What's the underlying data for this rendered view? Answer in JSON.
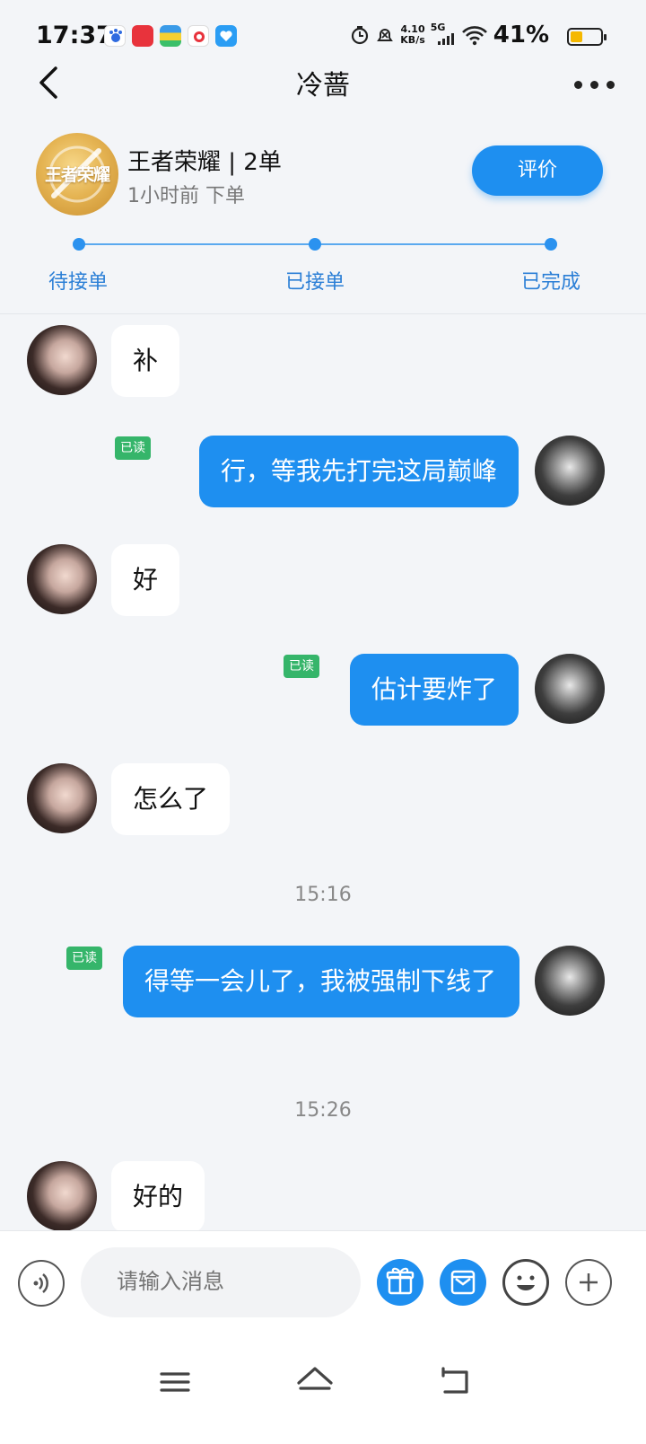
{
  "status_bar": {
    "time": "17:37",
    "net_speed_value": "4.10",
    "net_speed_unit": "KB/s",
    "network": "5G",
    "battery_percent": "41%",
    "battery_level": 0.41
  },
  "header": {
    "title": "冷蔷"
  },
  "order": {
    "logo_text": "王者荣耀",
    "title": "王者荣耀 | 2单",
    "subtitle": "1小时前 下单",
    "rate_button": "评价",
    "steps": [
      "待接单",
      "已接单",
      "已完成"
    ]
  },
  "messages": [
    {
      "side": "in",
      "text": "补"
    },
    {
      "side": "out",
      "text": "行，等我先打完这局巅峰",
      "read": "已读"
    },
    {
      "side": "in",
      "text": "好"
    },
    {
      "side": "out",
      "text": "估计要炸了",
      "read": "已读"
    },
    {
      "side": "in",
      "text": "怎么了"
    },
    {
      "side": "time",
      "text": "15:16"
    },
    {
      "side": "out",
      "text": "得等一会儿了，我被强制下线了",
      "read": "已读"
    },
    {
      "side": "time",
      "text": "15:26"
    },
    {
      "side": "in",
      "text": "好的"
    }
  ],
  "input": {
    "placeholder": "请输入消息"
  },
  "colors": {
    "accent": "#1e8ff0",
    "read_badge": "#35b56a",
    "background": "#f3f5f8"
  },
  "icons": [
    "back-icon",
    "more-icon",
    "voice-icon",
    "gift-icon",
    "coupon-icon",
    "emoji-icon",
    "plus-icon",
    "menu-icon",
    "home-icon",
    "return-icon"
  ]
}
